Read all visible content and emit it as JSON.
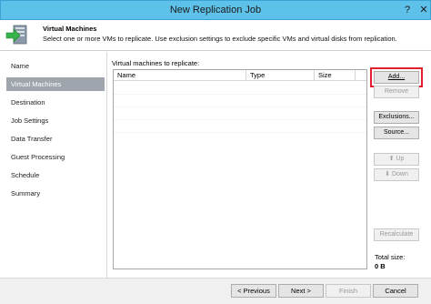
{
  "window": {
    "title": "New Replication Job",
    "help_glyph": "?",
    "close_glyph": "✕"
  },
  "header": {
    "title": "Virtual Machines",
    "description": "Select one or more VMs to replicate. Use exclusion settings to exclude specific VMs and virtual disks from replication."
  },
  "steps": [
    {
      "label": "Name",
      "active": false
    },
    {
      "label": "Virtual Machines",
      "active": true
    },
    {
      "label": "Destination",
      "active": false
    },
    {
      "label": "Job Settings",
      "active": false
    },
    {
      "label": "Data Transfer",
      "active": false
    },
    {
      "label": "Guest Processing",
      "active": false
    },
    {
      "label": "Schedule",
      "active": false
    },
    {
      "label": "Summary",
      "active": false
    }
  ],
  "vm_list": {
    "label": "Virtual machines to replicate:",
    "columns": [
      "Name",
      "Type",
      "Size"
    ],
    "rows": []
  },
  "side_buttons": {
    "add": {
      "label": "Add...",
      "enabled": true,
      "highlighted": true
    },
    "remove": {
      "label": "Remove",
      "enabled": false
    },
    "exclusions": {
      "label": "Exclusions...",
      "enabled": true
    },
    "source": {
      "label": "Source...",
      "enabled": true
    },
    "up": {
      "label": "Up",
      "enabled": false,
      "arrow": "⬆"
    },
    "down": {
      "label": "Down",
      "enabled": false,
      "arrow": "⬇"
    },
    "recalculate": {
      "label": "Recalculate",
      "enabled": false
    }
  },
  "total": {
    "label": "Total size:",
    "value": "0 B"
  },
  "footer": {
    "previous": {
      "label": "< Previous",
      "enabled": true
    },
    "next": {
      "label": "Next >",
      "enabled": true
    },
    "finish": {
      "label": "Finish",
      "enabled": false
    },
    "cancel": {
      "label": "Cancel",
      "enabled": true
    }
  },
  "colors": {
    "titlebar": "#5ec1ea",
    "active_step": "#9ea5ad",
    "highlight": "#e0202a"
  }
}
